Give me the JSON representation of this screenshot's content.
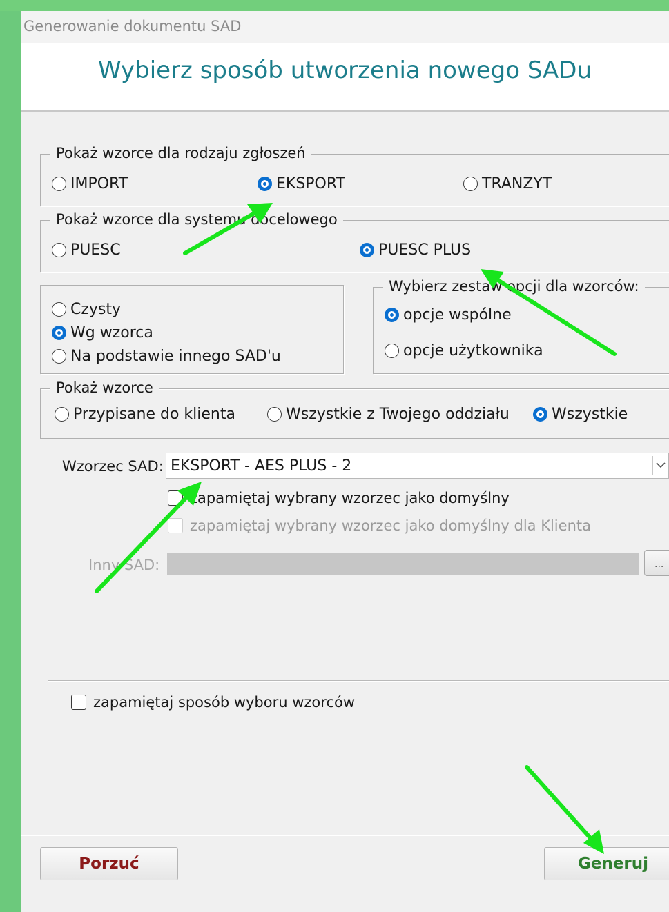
{
  "window": {
    "title": "Generowanie dokumentu SAD"
  },
  "header": {
    "heading": "Wybierz sposób utworzenia nowego SADu"
  },
  "group_type": {
    "legend": "Pokaż wzorce dla rodzaju zgłoszeń",
    "options": [
      {
        "label": "IMPORT",
        "selected": false
      },
      {
        "label": "EKSPORT",
        "selected": true
      },
      {
        "label": "TRANZYT",
        "selected": false
      }
    ]
  },
  "group_system": {
    "legend": "Pokaż wzorce dla systemu docelowego",
    "options": [
      {
        "label": "PUESC",
        "selected": false
      },
      {
        "label": "PUESC PLUS",
        "selected": true
      }
    ]
  },
  "group_mode": {
    "options": [
      {
        "label": "Czysty",
        "selected": false
      },
      {
        "label": "Wg wzorca",
        "selected": true
      },
      {
        "label": "Na podstawie innego SAD'u",
        "selected": false
      }
    ]
  },
  "group_optset": {
    "legend": "Wybierz zestaw opcji dla wzorców:",
    "options": [
      {
        "label": "opcje wspólne",
        "selected": true
      },
      {
        "label": "opcje użytkownika",
        "selected": false
      }
    ]
  },
  "group_show": {
    "legend": "Pokaż wzorce",
    "options": [
      {
        "label": "Przypisane do klienta",
        "selected": false
      },
      {
        "label": "Wszystkie z Twojego oddziału",
        "selected": false
      },
      {
        "label": "Wszystkie",
        "selected": true
      }
    ]
  },
  "template": {
    "label": "Wzorzec SAD:",
    "value": "EKSPORT - AES PLUS - 2",
    "remember_default": "zapamiętaj wybrany wzorzec jako domyślny",
    "remember_default_client": "zapamiętaj wybrany wzorzec jako domyślny dla Klienta"
  },
  "other_sad": {
    "label": "Inny SAD:",
    "button": "..."
  },
  "remember_method": "zapamiętaj sposób wyboru wzorców",
  "buttons": {
    "cancel": "Porzuć",
    "generate": "Generuj"
  },
  "colors": {
    "arrow": "#18e51c",
    "heading": "#1b7d8b",
    "radio_selected": "#0a6fd0",
    "generate": "#2f7f2f",
    "cancel": "#8b1a1a"
  }
}
